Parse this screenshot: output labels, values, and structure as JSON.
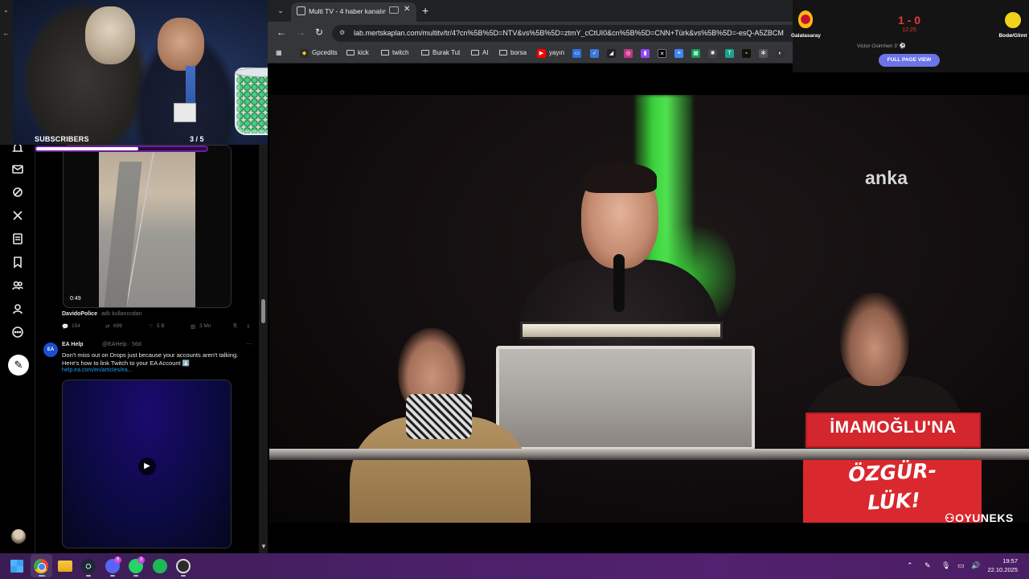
{
  "twitter": {
    "video1_duration": "0:49",
    "post1": {
      "author": "DavidoPolice",
      "source": "adlı kullanıcıdan",
      "replies": "154",
      "reposts": "699",
      "likes": "5 B",
      "views": "3 Mn"
    },
    "post2": {
      "avatar_text": "EA",
      "author": "EA Help",
      "handle": "@EAHelp · 56d",
      "text": "Don't miss out on Drops just because your accounts aren't talking. Here's how to link Twitch to your EA Account ⬇️",
      "url": "help.ea.com/en/articles/ea..."
    }
  },
  "overlay": {
    "subs_label": "SUBSCRIBERS",
    "subs_count": "3  / 5",
    "subs_progress": 0.6
  },
  "browser": {
    "tab_title": "Multi TV - 4 haber kanalını",
    "url": "lab.mertskaplan.com/multitv/tr/4?cn%5B%5D=NTV&vs%5B%5D=ztmY_cCtUI0&cn%5B%5D=CNN+Türk&vs%5B%5D=-esQ-A5ZBCM",
    "bookmarks": [
      "Gpcedits",
      "kick",
      "twitch",
      "Burak Tut",
      "AI",
      "borsa",
      "yayın"
    ]
  },
  "score": {
    "home": "Galatasaray",
    "away": "Bodø/Glimt",
    "result": "1 - 0",
    "minute": "12:25",
    "scorer": "Victor Osimhen 3'",
    "full_page_label": "FULL PAGE VIEW"
  },
  "stream": {
    "channel_logo": "anka",
    "sign_top": "İMAMOĞLU'NA",
    "sign_bottom_1": "ÖZGÜR-",
    "sign_bottom_2": "LÜK!",
    "watermark": "OYUNEKS"
  },
  "taskbar": {
    "discord_badge": "9",
    "whatsapp_badge": "3",
    "time": "19:57",
    "date": "22.10.2025"
  }
}
